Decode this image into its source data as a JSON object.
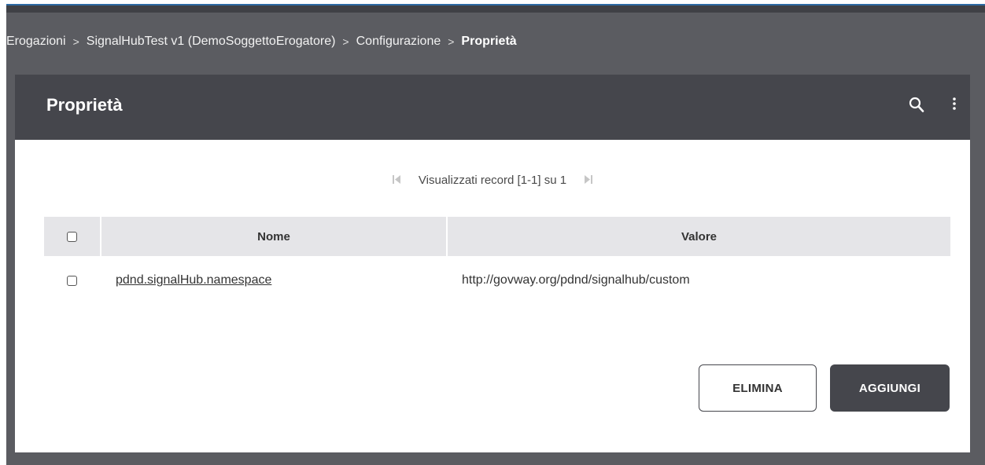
{
  "breadcrumb": {
    "items": [
      "Erogazioni",
      "SignalHubTest v1 (DemoSoggettoErogatore)",
      "Configurazione"
    ],
    "current": "Proprietà",
    "separator": ">"
  },
  "panel": {
    "title": "Proprietà",
    "icons": [
      "search-icon",
      "more-vert-icon"
    ]
  },
  "pager": {
    "text": "Visualizzati record [1-1] su 1",
    "first_icon": "first-page-icon",
    "last_icon": "last-page-icon"
  },
  "table": {
    "columns": [
      "Nome",
      "Valore"
    ],
    "rows": [
      {
        "nome": "pdnd.signalHub.namespace",
        "valore": "http://govway.org/pdnd/signalhub/custom"
      }
    ]
  },
  "actions": {
    "delete_label": "ELIMINA",
    "add_label": "AGGIUNGI"
  },
  "colors": {
    "header_bg": "#45464c",
    "frame_bg": "#5b5c61",
    "table_header_bg": "#e5e5e8"
  }
}
